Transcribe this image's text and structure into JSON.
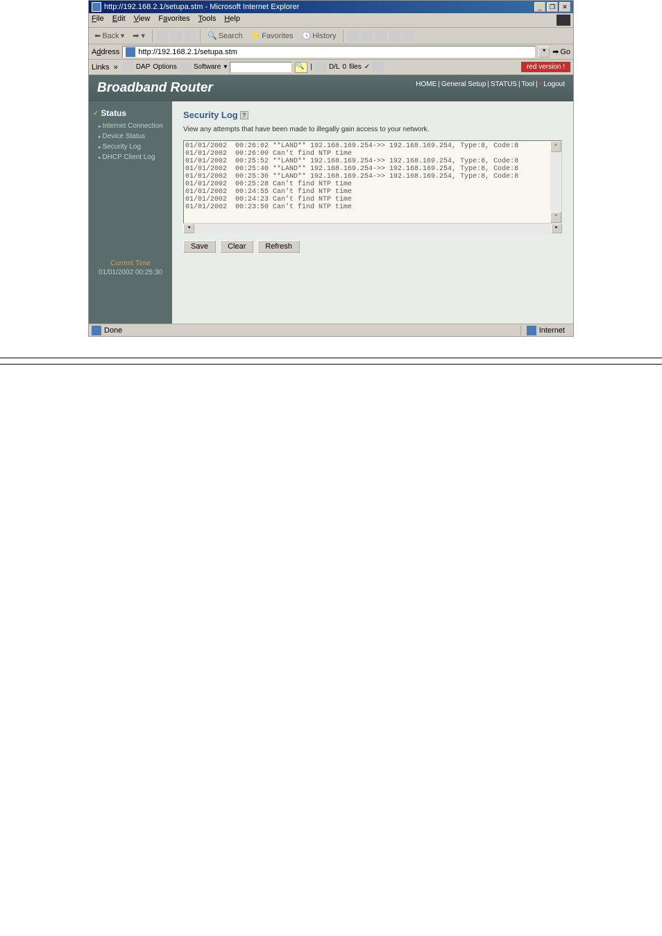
{
  "window": {
    "title": "http://192.168.2.1/setupa.stm - Microsoft Internet Explorer",
    "minimize": "_",
    "restore": "❐",
    "close": "✕"
  },
  "menu": {
    "file": "File",
    "edit": "Edit",
    "view": "View",
    "favorites": "Favorites",
    "tools": "Tools",
    "help": "Help"
  },
  "toolbar": {
    "back": "Back",
    "search": "Search",
    "favorites": "Favorites",
    "history": "History"
  },
  "address": {
    "label": "Address",
    "url": "http://192.168.2.1/setupa.stm",
    "go": "Go"
  },
  "links": {
    "label": "Links",
    "dap": "DAP",
    "options": "Options",
    "software": "Software",
    "dl": "D/L",
    "files_count": "0",
    "files": "files",
    "red_banner": "red version !"
  },
  "router": {
    "title": "Broadband Router",
    "nav": {
      "home": "HOME",
      "general": "General Setup",
      "status": "STATUS",
      "tool": "Tool",
      "logout": "Logout"
    }
  },
  "sidebar": {
    "header": "Status",
    "items": [
      {
        "label": "Internet Connection"
      },
      {
        "label": "Device Status"
      },
      {
        "label": "Security Log"
      },
      {
        "label": "DHCP Client Log"
      }
    ],
    "current_time_label": "Current Time",
    "current_time": "01/01/2002 00:25:30"
  },
  "content": {
    "title": "Security Log",
    "help": "?",
    "description": "View any attempts that have been made to illegally gain access to your network.",
    "log_lines": [
      "01/01/2002  00:26:02 **LAND** 192.168.169.254->> 192.168.169.254, Type:8, Code:8",
      "01/01/2002  00:26:00 Can't find NTP time",
      "01/01/2002  00:25:52 **LAND** 192.168.169.254->> 192.168.169.254, Type:8, Code:8",
      "01/01/2002  00:25:40 **LAND** 192.168.169.254->> 192.168.169.254, Type:8, Code:8",
      "01/01/2002  00:25:30 **LAND** 192.168.169.254->> 192.168.169.254, Type:8, Code:8",
      "01/01/2002  00:25:28 Can't find NTP time",
      "01/01/2002  00:24:55 Can't find NTP time",
      "01/01/2002  00:24:23 Can't find NTP time",
      "01/01/2002  00:23:50 Can't find NTP time"
    ],
    "buttons": {
      "save": "Save",
      "clear": "Clear",
      "refresh": "Refresh"
    }
  },
  "status_bar": {
    "done": "Done",
    "internet": "Internet"
  }
}
